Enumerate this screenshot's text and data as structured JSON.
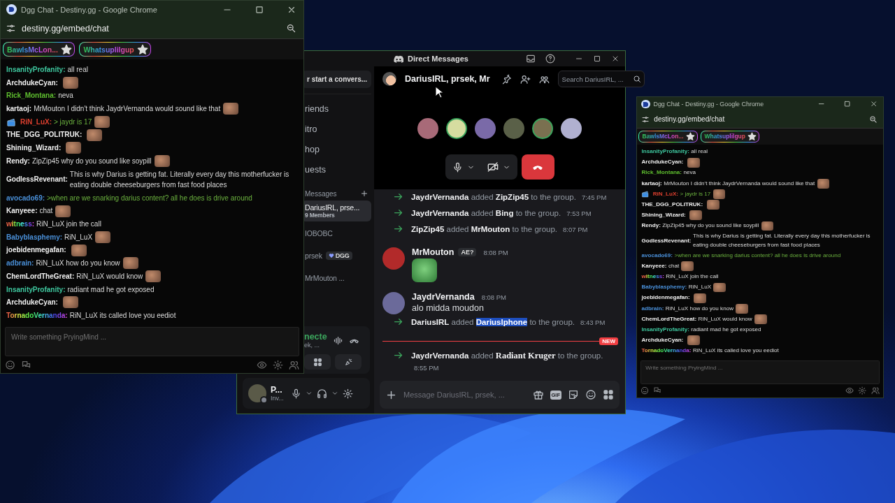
{
  "chat_windows": [
    {
      "title": "Dgg Chat - Destiny.gg - Google Chrome",
      "url": "destiny.gg/embed/chat",
      "pinned_users": [
        {
          "name": "BawlsMcLon..."
        },
        {
          "name": "Whatsuplilgup"
        }
      ],
      "messages": [
        {
          "user": "InsanityProfanity:",
          "color": "#3fc9a0",
          "rainbow": false,
          "kind": "plain",
          "text": "all real",
          "emote": false,
          "flair": false
        },
        {
          "user": "ArchdukeCyan:",
          "color": "#f2f2f2",
          "rainbow": false,
          "kind": "plain",
          "emote": true,
          "flair": false
        },
        {
          "user": "Rick_Montana:",
          "color": "#5fbf2f",
          "rainbow": false,
          "kind": "plain",
          "text": "neva",
          "emote": false,
          "flair": false
        },
        {
          "user": "kartaoj:",
          "color": "#f2f2f2",
          "rainbow": false,
          "kind": "plain",
          "text": "MrMouton I didn't think JaydrVernanda would sound like that",
          "emote": true,
          "flair": false
        },
        {
          "user": "RiN_LuX:",
          "color": "#e0402f",
          "rainbow": false,
          "kind": "greentext",
          "text": "> jaydr is 17",
          "emote": true,
          "flair": true
        },
        {
          "user": "THE_DGG_POLITRUK:",
          "color": "#f2f2f2",
          "rainbow": false,
          "kind": "plain",
          "emote": true,
          "flair": false
        },
        {
          "user": "Shining_Wizard:",
          "color": "#f2f2f2",
          "rainbow": false,
          "kind": "plain",
          "emote": true,
          "flair": false
        },
        {
          "user": "Rendy:",
          "color": "#f2f2f2",
          "rainbow": false,
          "kind": "plain",
          "text": "ZipZip45 why do you sound like soypill",
          "emote": true,
          "flair": false
        },
        {
          "user": "GodlessRevenant:",
          "color": "#f2f2f2",
          "rainbow": false,
          "kind": "plain",
          "text": "This is why Darius is getting fat. Literally every day this motherfucker is eating double cheeseburgers from fast food places",
          "emote": false,
          "flair": false
        },
        {
          "user": "avocado69:",
          "color": "#4a90d9",
          "rainbow": false,
          "kind": "greentext",
          "text": ">when are we snarking darius content? all he does is drive around",
          "emote": false,
          "flair": false
        },
        {
          "user": "Kanyeee:",
          "color": "#f2f2f2",
          "rainbow": false,
          "kind": "plain",
          "text": "chat",
          "emote": true,
          "flair": false
        },
        {
          "user": "witness:",
          "rainbow": true,
          "kind": "plain",
          "text": "RiN_LuX join the call",
          "emote": false,
          "flair": false
        },
        {
          "user": "Babyblasphemy:",
          "color": "#4a90d9",
          "rainbow": false,
          "kind": "plain",
          "text": "RiN_LuX",
          "emote": true,
          "flair": false
        },
        {
          "user": "joebidenmegafan:",
          "color": "#f2f2f2",
          "rainbow": false,
          "kind": "plain",
          "emote": true,
          "flair": false
        },
        {
          "user": "adbrain:",
          "color": "#4a90d9",
          "rainbow": false,
          "kind": "plain",
          "text": "RiN_LuX how do you know",
          "emote": true,
          "flair": false
        },
        {
          "user": "ChemLordTheGreat:",
          "color": "#f2f2f2",
          "rainbow": false,
          "kind": "plain",
          "text": "RiN_LuX would know",
          "emote": true,
          "flair": false
        },
        {
          "user": "InsanityProfanity:",
          "color": "#3fc9a0",
          "rainbow": false,
          "kind": "plain",
          "text": "radiant mad he got exposed",
          "emote": false,
          "flair": false
        },
        {
          "user": "ArchdukeCyan:",
          "color": "#f2f2f2",
          "rainbow": false,
          "kind": "plain",
          "emote": true,
          "flair": false
        },
        {
          "user": "TornadoVernanda:",
          "rainbow": true,
          "kind": "plain",
          "text": "RiN_LuX its called love you eediot",
          "emote": false,
          "flair": false
        }
      ],
      "input": {
        "placeholder": "Write something PryingMind ..."
      }
    },
    {
      "title": "Dgg Chat - Destiny.gg - Google Chrome",
      "url": "destiny.gg/embed/chat",
      "pinned_users": [
        {
          "name": "BawlsMcLon..."
        },
        {
          "name": "Whatsuplilgup"
        }
      ],
      "messages": [
        {
          "user": "InsanityProfanity:",
          "color": "#3fc9a0",
          "rainbow": false,
          "kind": "plain",
          "text": "all real",
          "emote": false,
          "flair": false
        },
        {
          "user": "ArchdukeCyan:",
          "color": "#f2f2f2",
          "rainbow": false,
          "kind": "plain",
          "emote": true,
          "flair": false
        },
        {
          "user": "Rick_Montana:",
          "color": "#5fbf2f",
          "rainbow": false,
          "kind": "plain",
          "text": "neva",
          "emote": false,
          "flair": false
        },
        {
          "user": "kartaoj:",
          "color": "#f2f2f2",
          "rainbow": false,
          "kind": "plain",
          "text": "MrMouton I didn't think JaydrVernanda would sound like that",
          "emote": true,
          "flair": false
        },
        {
          "user": "RiN_LuX:",
          "color": "#e0402f",
          "rainbow": false,
          "kind": "greentext",
          "text": "> jaydr is 17",
          "emote": true,
          "flair": true
        },
        {
          "user": "THE_DGG_POLITRUK:",
          "color": "#f2f2f2",
          "rainbow": false,
          "kind": "plain",
          "emote": true,
          "flair": false
        },
        {
          "user": "Shining_Wizard:",
          "color": "#f2f2f2",
          "rainbow": false,
          "kind": "plain",
          "emote": true,
          "flair": false
        },
        {
          "user": "Rendy:",
          "color": "#f2f2f2",
          "rainbow": false,
          "kind": "plain",
          "text": "ZipZip45 why do you sound like soypill",
          "emote": true,
          "flair": false
        },
        {
          "user": "GodlessRevenant:",
          "color": "#f2f2f2",
          "rainbow": false,
          "kind": "plain",
          "text": "This is why Darius is getting fat. Literally every day this motherfucker is eating double cheeseburgers from fast food places",
          "emote": false,
          "flair": false
        },
        {
          "user": "avocado69:",
          "color": "#4a90d9",
          "rainbow": false,
          "kind": "greentext",
          "text": ">when are we snarking darius content? all he does is drive around",
          "emote": false,
          "flair": false
        },
        {
          "user": "Kanyeee:",
          "color": "#f2f2f2",
          "rainbow": false,
          "kind": "plain",
          "text": "chat",
          "emote": true,
          "flair": false
        },
        {
          "user": "witness:",
          "rainbow": true,
          "kind": "plain",
          "text": "RiN_LuX join the call",
          "emote": false,
          "flair": false
        },
        {
          "user": "Babyblasphemy:",
          "color": "#4a90d9",
          "rainbow": false,
          "kind": "plain",
          "text": "RiN_LuX",
          "emote": true,
          "flair": false
        },
        {
          "user": "joebidenmegafan:",
          "color": "#f2f2f2",
          "rainbow": false,
          "kind": "plain",
          "emote": true,
          "flair": false
        },
        {
          "user": "adbrain:",
          "color": "#4a90d9",
          "rainbow": false,
          "kind": "plain",
          "text": "RiN_LuX how do you know",
          "emote": true,
          "flair": false
        },
        {
          "user": "ChemLordTheGreat:",
          "color": "#f2f2f2",
          "rainbow": false,
          "kind": "plain",
          "text": "RiN_LuX would know",
          "emote": true,
          "flair": false
        },
        {
          "user": "InsanityProfanity:",
          "color": "#3fc9a0",
          "rainbow": false,
          "kind": "plain",
          "text": "radiant mad he got exposed",
          "emote": false,
          "flair": false
        },
        {
          "user": "ArchdukeCyan:",
          "color": "#f2f2f2",
          "rainbow": false,
          "kind": "plain",
          "emote": true,
          "flair": false
        },
        {
          "user": "TornadoVernanda:",
          "rainbow": true,
          "kind": "plain",
          "text": "RiN_LuX its called love you eediot",
          "emote": false,
          "flair": false
        }
      ],
      "input": {
        "placeholder": "Write something PryingMind ..."
      }
    }
  ],
  "discord": {
    "title": "Direct Messages",
    "sidebar": {
      "search": "r start a convers...",
      "nav": [
        {
          "label": "riends"
        },
        {
          "label": "itro"
        },
        {
          "label": "hop"
        },
        {
          "label": "uests"
        }
      ],
      "section_title": "Messages",
      "dms": [
        {
          "name": "DariusIRL, prse...",
          "subtitle": "9 Members",
          "selected": true
        },
        {
          "name": "IOBOBC",
          "selected": false
        },
        {
          "name": "prsek",
          "tag": "DGG",
          "selected": false
        },
        {
          "name": "MrMouton ...",
          "selected": false
        }
      ],
      "voice": {
        "status": "necte",
        "channel": "ek, ..."
      },
      "user": {
        "name": "P...",
        "status": "Inv..."
      }
    },
    "header": {
      "title": "DariusIRL, prsek, Mr",
      "search_placeholder": "Search DariusIRL, ..."
    },
    "call": {
      "participants": [
        {
          "speaking": false
        },
        {
          "speaking": true
        },
        {
          "speaking": false
        },
        {
          "speaking": false
        },
        {
          "speaking": true
        },
        {
          "speaking": false
        }
      ]
    },
    "messages": [
      {
        "kind": "system",
        "actor": "JaydrVernanda",
        "action": "added",
        "target": "ZipZip45",
        "suffix": "to the group.",
        "time": "7:45 PM",
        "highlighted": false,
        "fancy": false
      },
      {
        "kind": "system",
        "actor": "JaydrVernanda",
        "action": "added",
        "target": "Bing",
        "suffix": "to the group.",
        "time": "7:53 PM",
        "highlighted": false,
        "fancy": false
      },
      {
        "kind": "system",
        "actor": "ZipZip45",
        "action": "added",
        "target": "MrMouton",
        "suffix": "to the group.",
        "time": "8:07 PM",
        "highlighted": false,
        "fancy": false
      },
      {
        "kind": "message",
        "author": "MrMouton",
        "tag": "AE?",
        "time": "8:08 PM",
        "emote": true
      },
      {
        "kind": "message",
        "author": "JaydrVernanda",
        "time": "8:08 PM",
        "text": "alo midda moudon",
        "emote": false
      },
      {
        "kind": "system",
        "actor": "DariusIRL",
        "action": "added",
        "target": "DariusIphone",
        "suffix": "to the group.",
        "time": "8:43 PM",
        "highlighted": true,
        "fancy": false
      },
      {
        "kind": "divider",
        "label": "NEW"
      },
      {
        "kind": "system",
        "actor": "JaydrVernanda",
        "action": "added",
        "target": "Radiant Kruger",
        "suffix": "to the group.",
        "time": "8:55 PM",
        "highlighted": false,
        "fancy": true
      }
    ],
    "composer": {
      "placeholder": "Message DariusIRL, prsek, ...",
      "gif_label": "GIF"
    }
  }
}
